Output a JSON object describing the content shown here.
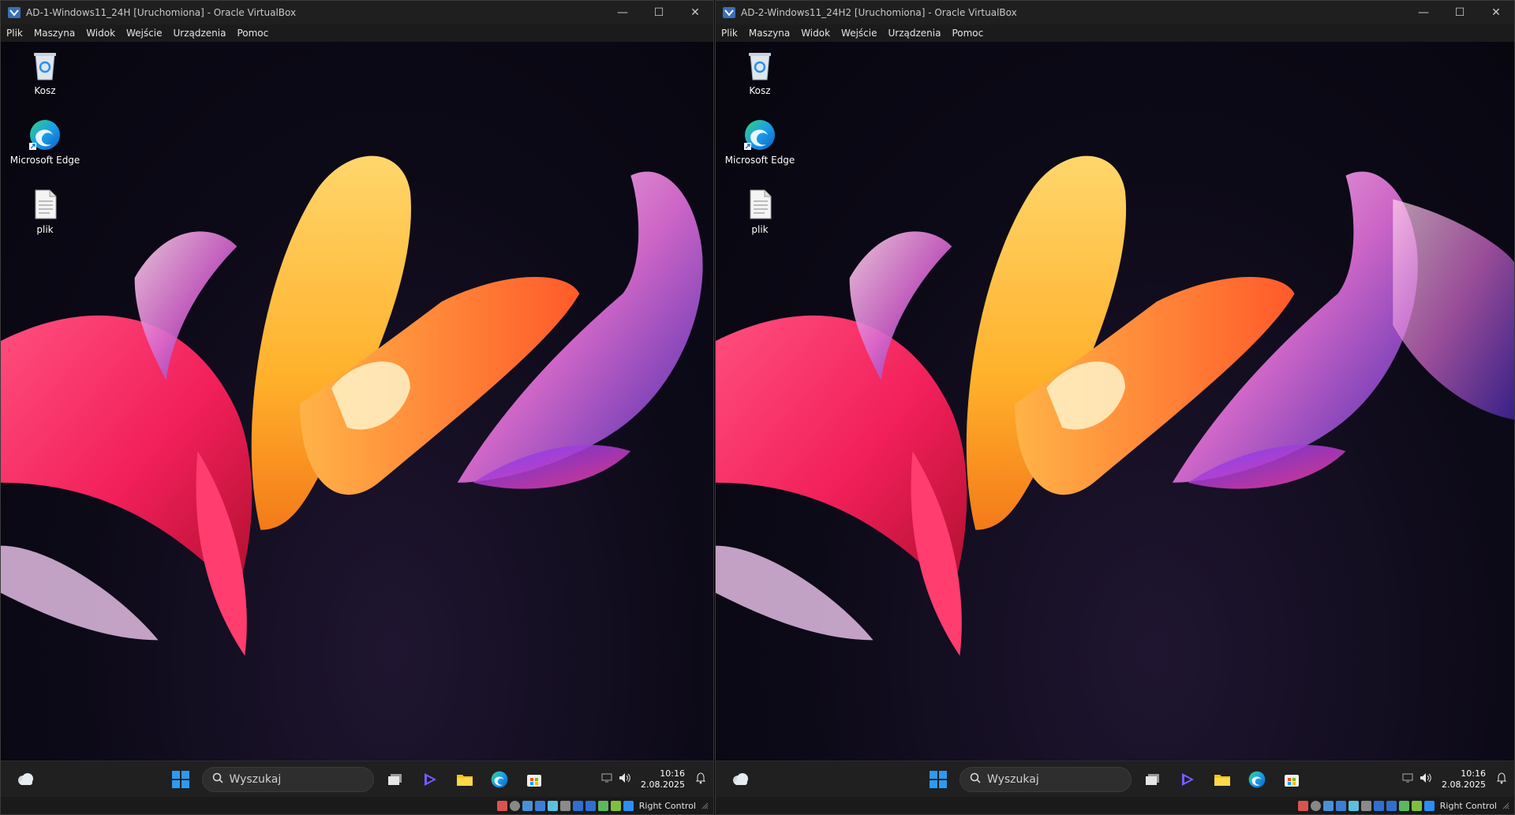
{
  "colors": {
    "titlebar_bg": "#1f1f1f",
    "taskbar_bg": "#202020",
    "accent_blue": "#2b8ef3"
  },
  "windows": [
    {
      "title": "AD-1-Windows11_24H [Uruchomiona] - Oracle VirtualBox",
      "menu": [
        "Plik",
        "Maszyna",
        "Widok",
        "Wejście",
        "Urządzenia",
        "Pomoc"
      ],
      "desktop_icons": [
        {
          "label": "Kosz",
          "icon": "recycle-bin-icon"
        },
        {
          "label": "Microsoft Edge",
          "icon": "edge-icon"
        },
        {
          "label": "plik",
          "icon": "text-file-icon"
        }
      ],
      "taskbar": {
        "search_placeholder": "Wyszukaj",
        "time": "10:16",
        "date": "2.08.2025"
      },
      "status": {
        "host_key": "Right Control"
      }
    },
    {
      "title": "AD-2-Windows11_24H2 [Uruchomiona] - Oracle VirtualBox",
      "menu": [
        "Plik",
        "Maszyna",
        "Widok",
        "Wejście",
        "Urządzenia",
        "Pomoc"
      ],
      "desktop_icons": [
        {
          "label": "Kosz",
          "icon": "recycle-bin-icon"
        },
        {
          "label": "Microsoft Edge",
          "icon": "edge-icon"
        },
        {
          "label": "plik",
          "icon": "text-file-icon"
        }
      ],
      "taskbar": {
        "search_placeholder": "Wyszukaj",
        "time": "10:16",
        "date": "2.08.2025"
      },
      "status": {
        "host_key": "Right Control"
      }
    }
  ]
}
